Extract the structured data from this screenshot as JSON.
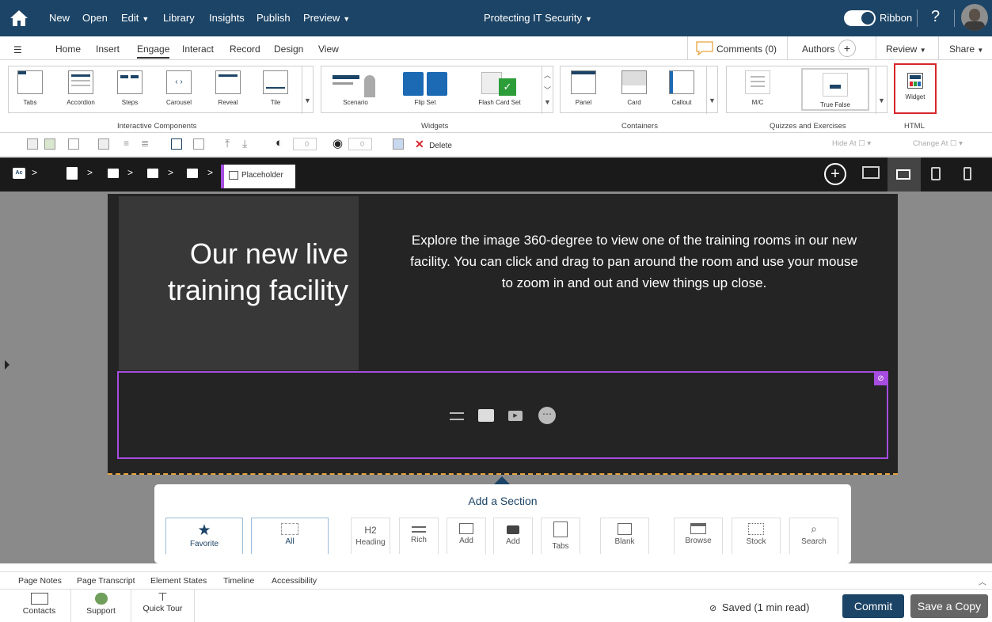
{
  "topbar": {
    "menu": [
      "New",
      "Open",
      "Edit",
      "Library",
      "Insights",
      "Publish",
      "Preview"
    ],
    "course_title": "Protecting IT Security",
    "ribbon_toggle_label": "Ribbon",
    "help": "?"
  },
  "tabs": [
    "Home",
    "Insert",
    "Engage",
    "Interact",
    "Record",
    "Design",
    "View"
  ],
  "active_tab": "Engage",
  "right_tabs": {
    "comments": "Comments (0)",
    "authors": "Authors",
    "review": "Review",
    "share": "Share"
  },
  "ribbon": {
    "interactive_components": {
      "label": "Interactive Components",
      "items": [
        "Tabs",
        "Accordion",
        "Steps",
        "Carousel",
        "Reveal",
        "Tile"
      ]
    },
    "widgets": {
      "label": "Widgets",
      "items": [
        "Scenario",
        "Flip Set",
        "Flash Card Set"
      ]
    },
    "containers": {
      "label": "Containers",
      "items": [
        "Panel",
        "Card",
        "Callout"
      ]
    },
    "quizzes": {
      "label": "Quizzes and Exercises",
      "items": [
        "M/C",
        "True False"
      ]
    },
    "html": {
      "label": "HTML",
      "items": [
        "Widget"
      ]
    }
  },
  "format_toolbar": {
    "spin1": "0",
    "spin2": "0",
    "delete_label": "Delete",
    "hide_at": "Hide At",
    "change_at": "Change At"
  },
  "breadcrumb": {
    "first_icon_text": "Ac",
    "last": "Placeholder"
  },
  "slide": {
    "heading": "Our new live training facility",
    "body": "Explore the image 360-degree to view one of the training rooms in our new facility. You can click and drag to pan around the room and use your mouse to zoom in and out and view things up close."
  },
  "add_section": {
    "title": "Add a Section",
    "items": [
      "Favorite",
      "All",
      "Heading",
      "Rich",
      "Add",
      "Add",
      "Tabs",
      "Blank",
      "Browse",
      "Stock",
      "Search"
    ],
    "heading_icon_text": "H2"
  },
  "page_notes_tabs": [
    "Page Notes",
    "Page Transcript",
    "Element States",
    "Timeline",
    "Accessibility"
  ],
  "footer": {
    "items": [
      "Contacts",
      "Support",
      "Quick Tour"
    ],
    "saved_status": "Saved (1 min read)",
    "commit": "Commit",
    "save_copy": "Save a Copy"
  },
  "colors": {
    "topbar": "#1c4466",
    "accent_purple": "#a64ce0",
    "highlight_red": "#d7262c",
    "commit_button": "#1c4466",
    "save_copy_button": "#666666"
  }
}
